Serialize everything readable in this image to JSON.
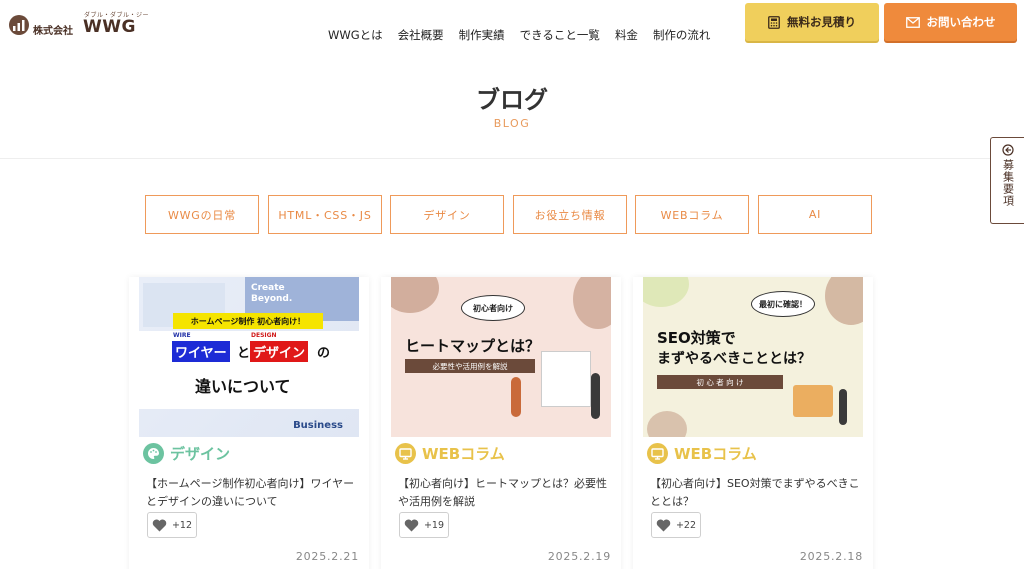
{
  "header": {
    "logo_ruby": "ダブル・ダブル・ジー",
    "logo_company": "株式会社",
    "logo_brand": "WWG",
    "nav": [
      "WWGとは",
      "会社概要",
      "制作実績",
      "できること一覧",
      "料金",
      "制作の流れ"
    ],
    "estimate_label": "無料お見積り",
    "contact_label": "お問い合わせ"
  },
  "page": {
    "title": "ブログ",
    "subtitle": "BLOG"
  },
  "side_tab": {
    "label": "募集要項"
  },
  "categories": [
    "WWGの日常",
    "HTML・CSS・JS",
    "デザイン",
    "お役立ち情報",
    "WEBコラム",
    "AI"
  ],
  "cards": [
    {
      "category": "デザイン",
      "category_icon": "palette-icon",
      "category_color": "#6cc3a0",
      "title": "【ホームページ制作初心者向け】ワイヤーとデザインの違いについて",
      "likes": "+12",
      "date": "2025.2.21",
      "thumb": {
        "create_text": "Create Beyond.",
        "badge": "ホームページ制作 初心者向け！",
        "wire_ruby": "WIRE",
        "design_ruby": "DESIGN",
        "wire": "ワイヤー",
        "to": "と",
        "design": "デザイン",
        "no": "の",
        "line2": "違いについて",
        "business": "Business"
      }
    },
    {
      "category": "WEBコラム",
      "category_icon": "monitor-icon",
      "category_color": "#e8c24a",
      "title": "【初心者向け】ヒートマップとは？必要性や活用例を解説",
      "likes": "+19",
      "date": "2025.2.19",
      "thumb": {
        "bubble": "初心者向け",
        "headline": "ヒートマップとは？",
        "band": "必要性や活用例を解説"
      }
    },
    {
      "category": "WEBコラム",
      "category_icon": "monitor-icon",
      "category_color": "#e8c24a",
      "title": "【初心者向け】SEO対策でまずやるべきこととは？",
      "likes": "+22",
      "date": "2025.2.18",
      "thumb": {
        "bubble": "最初に確認！",
        "line1": "SEO対策で",
        "line2": "まずやるべきこととは？",
        "band": "初 心 者 向 け"
      }
    }
  ]
}
